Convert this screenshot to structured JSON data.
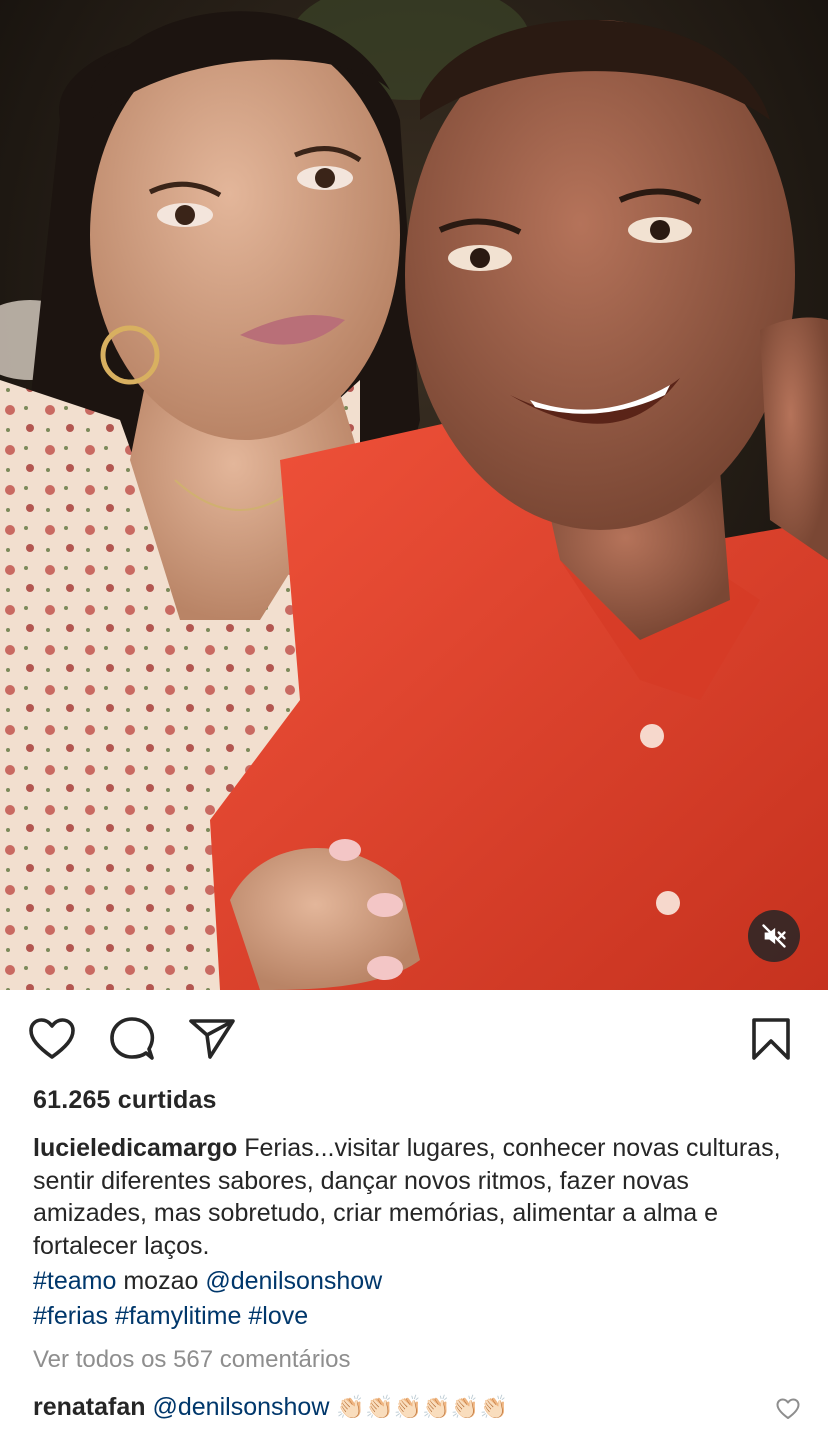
{
  "post": {
    "media": {
      "type": "photo",
      "description_icon": "selfie-photo"
    },
    "mute_icon": "speaker-muted-icon",
    "actions": {
      "like_icon": "heart-icon",
      "comment_icon": "comment-bubble-icon",
      "share_icon": "paper-plane-icon",
      "save_icon": "bookmark-icon"
    },
    "likes_text": "61.265 curtidas",
    "caption": {
      "username": "lucieledicamargo",
      "text": "Ferias...visitar lugares, conhecer novas culturas, sentir diferentes sabores, dançar novos ritmos, fazer novas amizades, mas sobretudo, criar memórias, alimentar a alma e fortalecer laços.",
      "line1": {
        "hashtag": "#teamo",
        "word": "mozao",
        "mention": "@denilsonshow"
      },
      "line2": {
        "tags": [
          "#ferias",
          "#famylitime",
          "#love"
        ]
      }
    },
    "view_comments_text": "Ver todos os 567 comentários",
    "comment": {
      "username": "renatafan",
      "mention": "@denilsonshow",
      "emojis": "👏🏻👏🏻👏🏻👏🏻👏🏻👏🏻",
      "like_icon": "small-heart-icon"
    },
    "colors": {
      "text": "#262626",
      "link": "#00376b",
      "muted": "#8e8e8e",
      "background": "#ffffff"
    }
  }
}
